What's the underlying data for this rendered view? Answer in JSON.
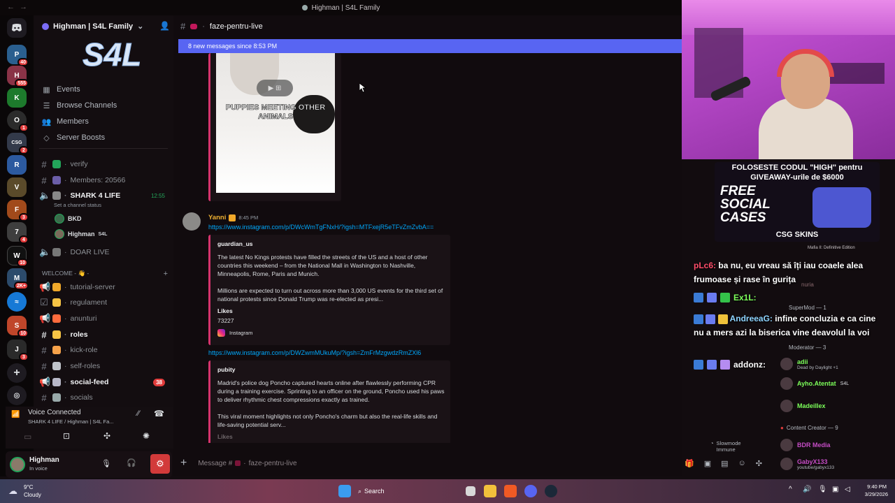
{
  "window": {
    "title": "Highman | S4L Family"
  },
  "rail": {
    "badges": [
      "40",
      "555",
      "1",
      "2",
      "3",
      "4",
      "1",
      "10",
      "4",
      "2K+",
      "10",
      "1",
      "3"
    ]
  },
  "sidebar": {
    "server_name": "Highman | S4L Family",
    "nav": [
      {
        "label": "Events",
        "icon": "calendar-icon"
      },
      {
        "label": "Browse Channels",
        "icon": "browse-icon"
      },
      {
        "label": "Members",
        "icon": "members-icon"
      },
      {
        "label": "Server Boosts",
        "icon": "boost-icon"
      }
    ],
    "channels": {
      "verify": "verify",
      "members_count": "Members: 20566",
      "shark": "SHARK 4 LIFE",
      "shark_time": "12:55",
      "channel_status": "Set a channel status",
      "voice_user_1": "BKD",
      "voice_user_2": "Highman",
      "voice_user_2_tag": "S4L",
      "doar_live": "DOAR LIVE",
      "category": "WELCOME - 👋 -",
      "tutorial": "tutorial-server",
      "regulament": "regulament",
      "anunturi": "anunturi",
      "roles": "roles",
      "kick_role": "kick-role",
      "self_roles": "self-roles",
      "social_feed": "social-feed",
      "social_feed_mentions": "38",
      "socials": "socials"
    }
  },
  "voice": {
    "status": "Voice Connected",
    "location": "SHARK 4 LIFE / Highman | S4L Fa..."
  },
  "user": {
    "name": "Highman",
    "status": "In voice"
  },
  "chat": {
    "channel": "faze-pentru-live",
    "new_messages": "8 new messages since 8:53 PM",
    "video_caption": "PUPPIES MEETING OTHER ANIMALS",
    "msg_author": "Yanni",
    "msg_time": "8:45 PM",
    "link1": "https://www.instagram.com/p/DWcWmTgFNxH/?igsh=MTFxejR5eTFvZmZvbA==",
    "embed1": {
      "author": "guardian_us",
      "p1": "The latest No Kings protests have filled the streets of the US and a host of other countries this weekend – from the National Mall in Washington to Nashville, Minneapolis, Rome, Paris and Munich.",
      "p2": "Millions are expected to turn out across more than 3,000 US events for the third set of national protests since Donald Trump was re-elected as presi...",
      "likes_label": "Likes",
      "likes_value": "73227",
      "footer": "Instagram"
    },
    "link2": "https://www.instagram.com/p/DWZwmMUkuMp/?igsh=ZmFrMzgwdzRmZXl6",
    "embed2": {
      "author": "pubity",
      "p1": "Madrid's police dog Poncho captured hearts online after flawlessly performing CPR during a training exercise. Sprinting to an officer on the ground, Poncho used his paws to deliver rhythmic chest compressions exactly as trained.",
      "p2": "This viral moment highlights not only Poncho's charm but also the real-life skills and life-saving potential serv...",
      "likes_label": "Likes"
    },
    "slowmode": "Slowmode Immune",
    "composer_placeholder": "Message #",
    "composer_channel": "faze-pentru-live"
  },
  "overlay": {
    "promo_line1": "FOLOSESTE CODUL \"HIGH\" pentru",
    "promo_line2": "GIVEAWAY-urile de $6000",
    "promo_big": "FREE SOCIAL CASES",
    "promo_brand": "CSG SKINS",
    "chat": [
      {
        "user": "pLc6:",
        "text": "ba nu, eu vreau să îți iau coaele alea frumoase și rase în gurița",
        "color": "#ff4d6a"
      },
      {
        "user": "Ex1L:",
        "text": "",
        "color": "#7cff5a"
      },
      {
        "user": "AndreeaG:",
        "text": "infine concluzia e ca cine nu a mers azi la biserica vine deavolul la voi",
        "color": "#8dd4ff"
      },
      {
        "user": "addonz:",
        "text": "",
        "color": "#ffffff"
      }
    ],
    "members": {
      "supermod": "SuperMod — 1",
      "moderator": "Moderator — 3",
      "m1": "adii",
      "m1_sub": "Dead by Daylight +1",
      "m2": "Ayho.Atentat",
      "m2_tag": "S4L",
      "m3": "Madeillex",
      "content_creator": "Content Creator — 9",
      "m4": "BDR Media",
      "m5": "GabyX133",
      "m5_sub": "youtube/gabyx133",
      "edition": "Mafia II: Definitive Edition",
      "nuria": "nuria"
    }
  },
  "taskbar": {
    "weather_temp": "9°C",
    "weather_desc": "Cloudy",
    "search": "Search",
    "time": "9:40 PM",
    "date": "3/29/2026"
  }
}
